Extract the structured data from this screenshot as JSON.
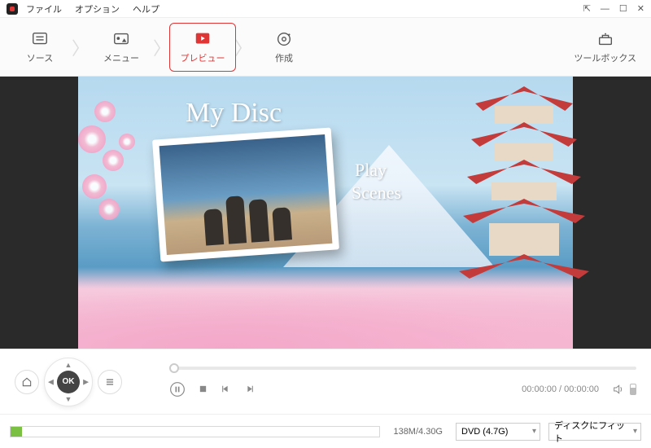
{
  "menubar": {
    "file": "ファイル",
    "options": "オプション",
    "help": "ヘルプ"
  },
  "window": {
    "pin": "⇱",
    "min": "—",
    "max": "☐",
    "close": "✕"
  },
  "steps": {
    "source": "ソース",
    "menu": "メニュー",
    "preview": "プレビュー",
    "create": "作成",
    "toolbox": "ツールボックス"
  },
  "disc_menu": {
    "title": "My Disc",
    "play": "Play",
    "scenes": "Scenes"
  },
  "nav": {
    "ok": "OK"
  },
  "playback": {
    "time_current": "00:00:00",
    "time_total": "00:00:00",
    "sep": " / "
  },
  "status": {
    "size": "138M/4.30G",
    "disc_type": "DVD (4.7G)",
    "fit": "ディスクにフィット"
  }
}
